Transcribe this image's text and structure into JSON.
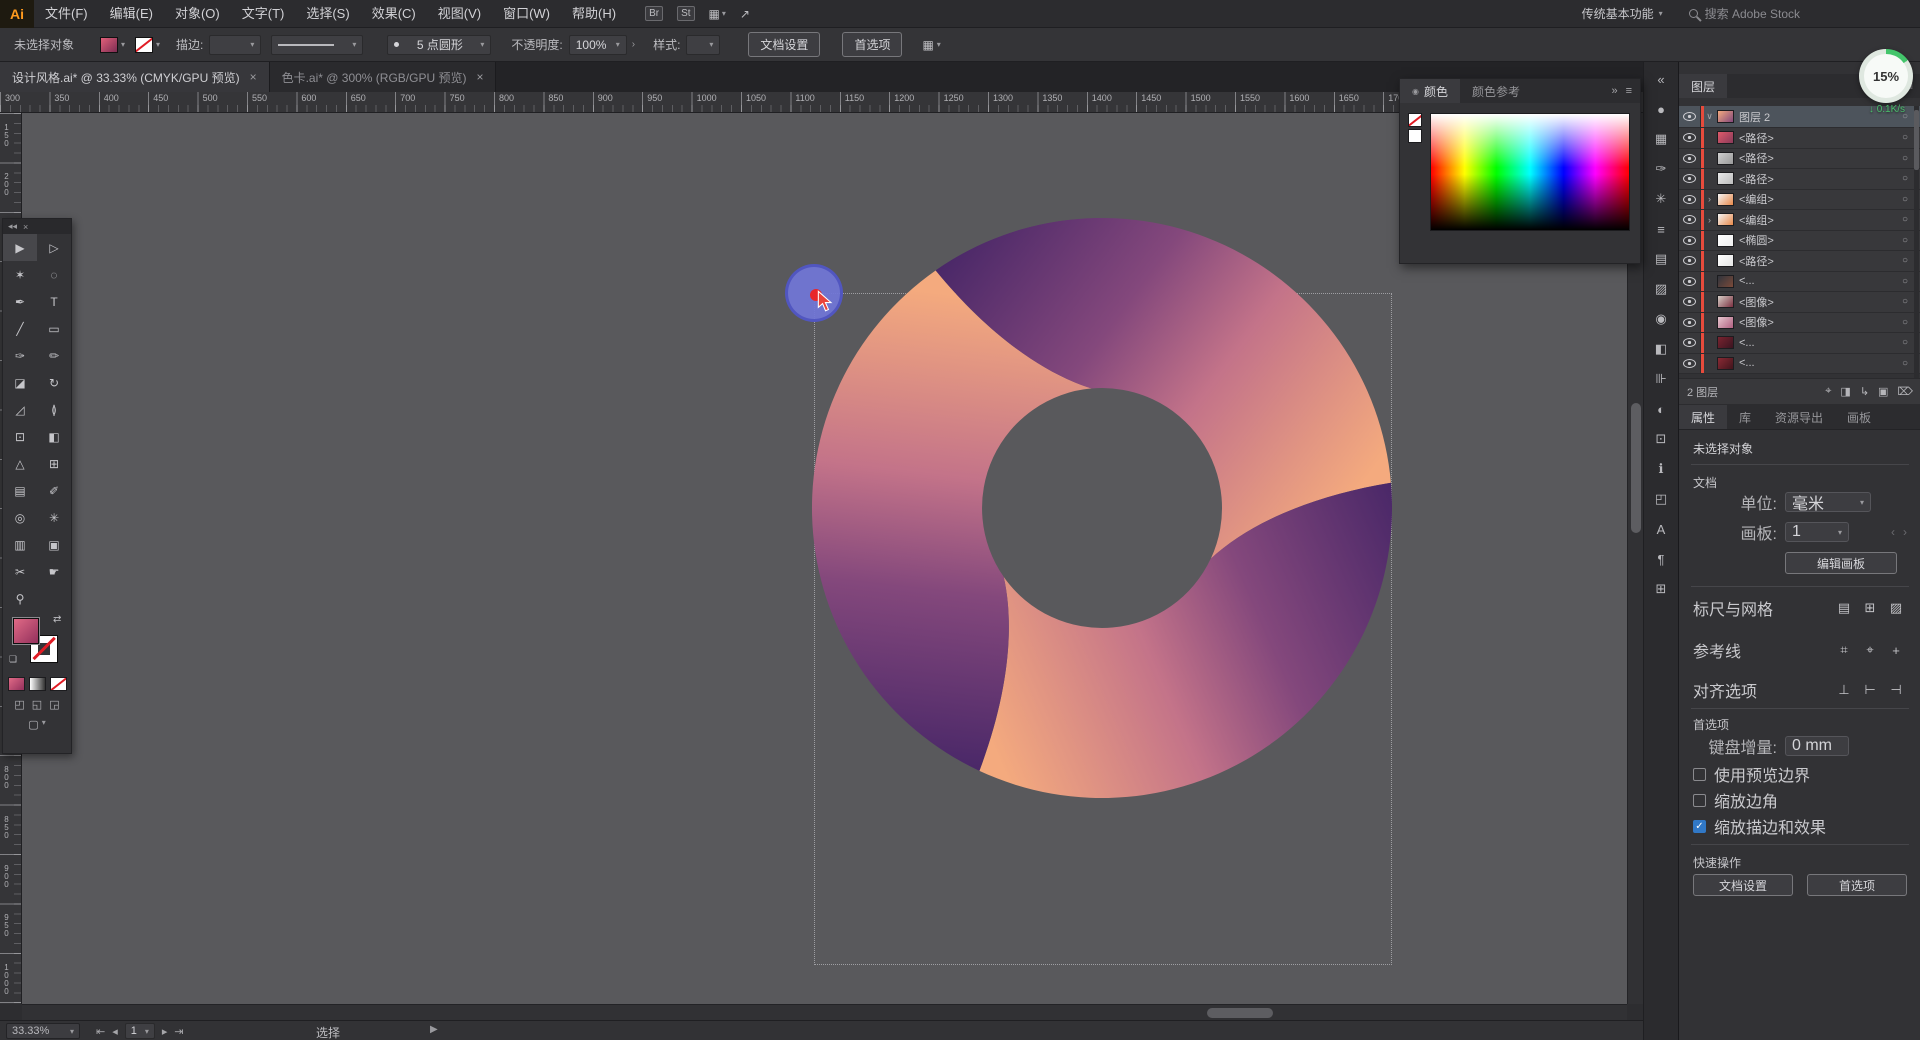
{
  "app": {
    "logo": "Ai"
  },
  "icons": {
    "caret": "▾",
    "close": "×",
    "menu": "≡",
    "dbl_chevron": "»",
    "collapse": "«",
    "target": "○",
    "expand": "›",
    "swap": "⇄",
    "share": "↗",
    "grid": "▦",
    "expander": "▶",
    "down_arrow": "↓",
    "dot": "◉",
    "default_swatches": "❏",
    "chevron_open": "∨",
    "left_dim": "‹",
    "right_dim": "›",
    "dock_left": "◂◂"
  },
  "menubar": {
    "items": [
      "文件(F)",
      "编辑(E)",
      "对象(O)",
      "文字(T)",
      "选择(S)",
      "效果(C)",
      "视图(V)",
      "窗口(W)",
      "帮助(H)"
    ],
    "bridge_badge": "Br",
    "stock_badge": "St",
    "workspace": "传统基本功能",
    "search_placeholder": "搜索 Adobe Stock"
  },
  "controlbar": {
    "no_selection": "未选择对象",
    "stroke_label": "描边:",
    "brush_name": "5 点圆形",
    "opacity_label": "不透明度:",
    "opacity_value": "100%",
    "style_label": "样式:",
    "doc_setup": "文档设置",
    "preferences": "首选项"
  },
  "tabs": [
    {
      "title": "设计风格.ai* @ 33.33% (CMYK/GPU 预览)",
      "close": "×"
    },
    {
      "title": "色卡.ai* @ 300% (RGB/GPU 预览)",
      "close": "×"
    }
  ],
  "ruler": {
    "h_start": 300,
    "h_step": 50,
    "h_count": 33,
    "v_start": 150,
    "v_step": 50,
    "v_count": 18
  },
  "toolbar": {
    "tools": [
      {
        "name": "selection-tool",
        "glyph": "▶"
      },
      {
        "name": "direct-selection-tool",
        "glyph": "▷"
      },
      {
        "name": "magic-wand-tool",
        "glyph": "✶"
      },
      {
        "name": "lasso-tool",
        "glyph": "◌"
      },
      {
        "name": "pen-tool",
        "glyph": "✒"
      },
      {
        "name": "type-tool",
        "glyph": "T"
      },
      {
        "name": "line-segment-tool",
        "glyph": "╱"
      },
      {
        "name": "rectangle-tool",
        "glyph": "▭"
      },
      {
        "name": "paintbrush-tool",
        "glyph": "✑"
      },
      {
        "name": "pencil-tool",
        "glyph": "✏"
      },
      {
        "name": "eraser-tool",
        "glyph": "◪"
      },
      {
        "name": "rotate-tool",
        "glyph": "↻"
      },
      {
        "name": "scale-tool",
        "glyph": "◿"
      },
      {
        "name": "width-tool",
        "glyph": "≬"
      },
      {
        "name": "free-transform-tool",
        "glyph": "⊡"
      },
      {
        "name": "shape-builder-tool",
        "glyph": "◧"
      },
      {
        "name": "perspective-grid-tool",
        "glyph": "△"
      },
      {
        "name": "mesh-tool",
        "glyph": "⊞"
      },
      {
        "name": "gradient-tool",
        "glyph": "▤"
      },
      {
        "name": "eyedropper-tool",
        "glyph": "✐"
      },
      {
        "name": "blend-tool",
        "glyph": "◎"
      },
      {
        "name": "symbol-sprayer-tool",
        "glyph": "✳"
      },
      {
        "name": "column-graph-tool",
        "glyph": "▥"
      },
      {
        "name": "artboard-tool",
        "glyph": "▣"
      },
      {
        "name": "slice-tool",
        "glyph": "✂"
      },
      {
        "name": "hand-tool",
        "glyph": "☛"
      },
      {
        "name": "zoom-tool",
        "glyph": "⚲"
      },
      {
        "name": "empty-slot",
        "glyph": ""
      }
    ]
  },
  "dock": {
    "icons": [
      {
        "name": "collapse-panels-icon",
        "glyph": "«"
      },
      {
        "name": "panel-color-icon",
        "glyph": "●"
      },
      {
        "name": "panel-swatches-icon",
        "glyph": "▦"
      },
      {
        "name": "panel-brushes-icon",
        "glyph": "✑"
      },
      {
        "name": "panel-symbols-icon",
        "glyph": "✳"
      },
      {
        "name": "panel-stroke-icon",
        "glyph": "≡"
      },
      {
        "name": "panel-gradient-icon",
        "glyph": "▤"
      },
      {
        "name": "panel-transparency-icon",
        "glyph": "▨"
      },
      {
        "name": "panel-appearance-icon",
        "glyph": "◉"
      },
      {
        "name": "panel-graphic-styles-icon",
        "glyph": "◧"
      },
      {
        "name": "panel-align-icon",
        "glyph": "⊪"
      },
      {
        "name": "panel-pathfinder-icon",
        "glyph": "◐"
      },
      {
        "name": "panel-transform-icon",
        "glyph": "⊡"
      },
      {
        "name": "panel-info-icon",
        "glyph": "ℹ"
      },
      {
        "name": "panel-navigator-icon",
        "glyph": "◰"
      },
      {
        "name": "panel-character-icon",
        "glyph": "A"
      },
      {
        "name": "panel-paragraph-icon",
        "glyph": "¶"
      },
      {
        "name": "panel-links-icon",
        "glyph": "⊞"
      }
    ]
  },
  "color_panel": {
    "tab_color": "颜色",
    "tab_guide": "颜色参考"
  },
  "layers": {
    "title": "图层",
    "top_layer": {
      "label": "图层 2"
    },
    "rows": [
      {
        "label": "<路径>",
        "thumb1": "#e05a6a",
        "thumb2": "#8a3a5a"
      },
      {
        "label": "<路径>",
        "thumb1": "#cfcfcf",
        "thumb2": "#9a9a9a"
      },
      {
        "label": "<路径>",
        "thumb1": "#e8e8e8",
        "thumb2": "#bdbdbd"
      },
      {
        "label": "<编组>",
        "expand": true,
        "thumb1": "#f5f5f5",
        "thumb2": "#e8894a"
      },
      {
        "label": "<编组>",
        "expand": true,
        "thumb1": "#f5f5f5",
        "thumb2": "#e8894a"
      },
      {
        "label": "<椭圆>",
        "thumb1": "#ffffff",
        "thumb2": "#f0f0f0"
      },
      {
        "label": "<路径>",
        "thumb1": "#ffffff",
        "thumb2": "#e5e5e5"
      },
      {
        "label": "<...",
        "thumb1": "#30343c",
        "thumb2": "#7a4a3a"
      },
      {
        "label": "<图像>",
        "thumb1": "#d8d0c8",
        "thumb2": "#7a3040"
      },
      {
        "label": "<图像>",
        "thumb1": "#e8c8d0",
        "thumb2": "#b06080"
      },
      {
        "label": "<...",
        "thumb1": "#7a2430",
        "thumb2": "#3a1420"
      },
      {
        "label": "<...",
        "thumb1": "#8a2a34",
        "thumb2": "#40141c"
      }
    ],
    "footer": "2 图层",
    "footer_icons": [
      {
        "name": "locate-object-icon",
        "glyph": "⌖"
      },
      {
        "name": "make-clip-mask-icon",
        "glyph": "◨"
      },
      {
        "name": "new-sublayer-icon",
        "glyph": "↳"
      },
      {
        "name": "new-layer-icon",
        "glyph": "▣"
      },
      {
        "name": "delete-layer-icon",
        "glyph": "⌦"
      }
    ]
  },
  "properties": {
    "tabs": [
      "属性",
      "库",
      "资源导出",
      "画板"
    ],
    "no_selection": "未选择对象",
    "document_label": "文档",
    "unit_label": "单位:",
    "unit_value": "毫米",
    "artboard_label": "画板:",
    "artboard_value": "1",
    "edit_artboard": "编辑画板",
    "ruler_grid_label": "标尺与网格",
    "guides_label": "参考线",
    "snap_label": "对齐选项",
    "prefs_label": "首选项",
    "keyboard_label": "键盘增量:",
    "keyboard_value": "0 mm",
    "checkboxes": [
      {
        "label": "使用预览边界",
        "checked": false
      },
      {
        "label": "缩放边角",
        "checked": false
      },
      {
        "label": "缩放描边和效果",
        "checked": true
      }
    ],
    "quick_label": "快速操作",
    "quick_doc_setup": "文档设置",
    "quick_prefs": "首选项",
    "ruler_grid_icons": [
      {
        "name": "show-rulers-icon",
        "glyph": "▤"
      },
      {
        "name": "show-grid-icon",
        "glyph": "⊞"
      },
      {
        "name": "show-transparency-grid-icon",
        "glyph": "▨"
      }
    ],
    "guides_icons": [
      {
        "name": "show-guides-icon",
        "glyph": "⌗"
      },
      {
        "name": "lock-guides-icon",
        "glyph": "⌖"
      },
      {
        "name": "make-guides-icon",
        "glyph": "+"
      }
    ],
    "snap_icons": [
      {
        "name": "snap-to-grid-icon",
        "glyph": "⊥"
      },
      {
        "name": "snap-to-point-icon",
        "glyph": "⊢"
      },
      {
        "name": "snap-to-pixel-icon",
        "glyph": "⊣"
      }
    ]
  },
  "statusbar": {
    "zoom": "33.33%",
    "artboard": "1",
    "tool": "选择",
    "nav": [
      "⇤",
      "◂",
      "▸",
      "⇥"
    ]
  },
  "overlay": {
    "badge_percent": "15%",
    "badge_speed": "0.1K/s"
  },
  "logo_colors": {
    "purple": "#472667",
    "plum": "#84487c",
    "pink": "#c37389",
    "salmon": "#f4aa7e"
  }
}
